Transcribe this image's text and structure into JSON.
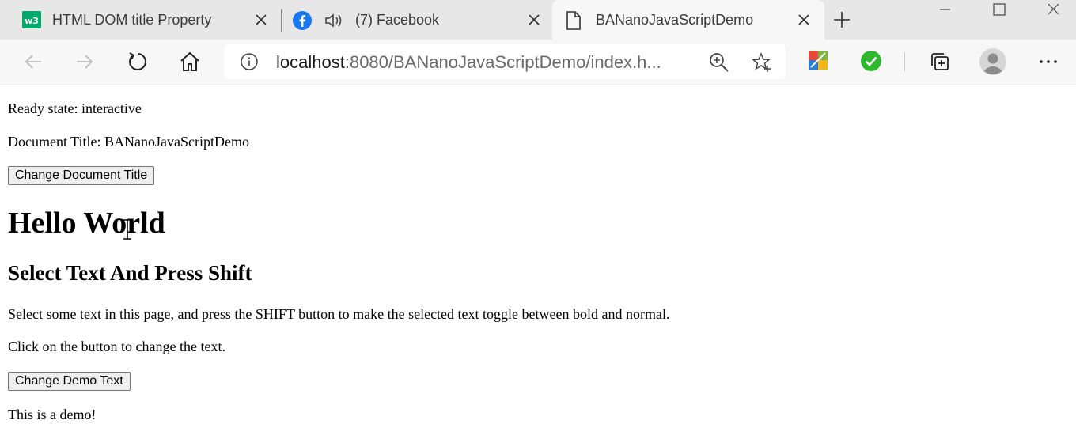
{
  "tabs": [
    {
      "title": "HTML DOM title Property",
      "favicon": "w3schools-icon"
    },
    {
      "title": "(7) Facebook",
      "favicon": "facebook-icon",
      "audio": true
    },
    {
      "title": "BANanoJavaScriptDemo",
      "favicon": "document-icon",
      "active": true
    }
  ],
  "address": {
    "host": "localhost",
    "rest": ":8080/BANanoJavaScriptDemo/index.h..."
  },
  "page": {
    "ready_state": "Ready state: interactive",
    "document_title": "Document Title: BANanoJavaScriptDemo",
    "change_title_button": "Change Document Title",
    "heading": "Hello World",
    "subheading": "Select Text And Press Shift",
    "instructions": "Select some text in this page, and press the SHIFT button to make the selected text toggle between bold and normal.",
    "click_hint": "Click on the button to change the text.",
    "change_text_button": "Change Demo Text",
    "demo_text": "This is a demo!"
  },
  "colors": {
    "facebook": "#1877f2",
    "w3schools": "#04aa6d",
    "check": "#2eb82e"
  }
}
